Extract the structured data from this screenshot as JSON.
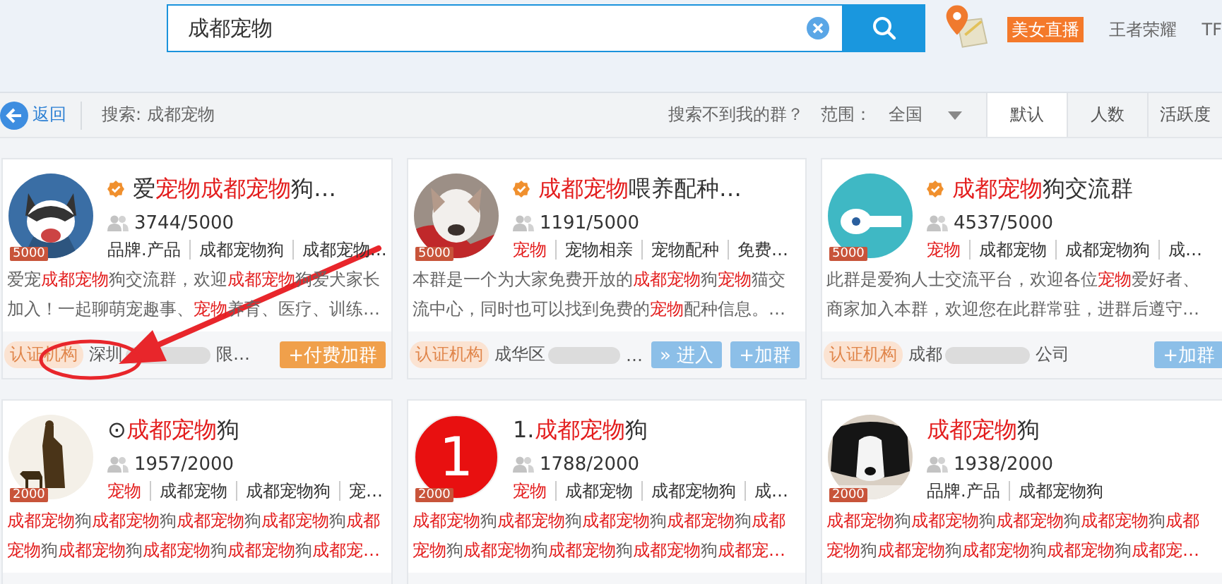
{
  "search": {
    "value": "成都宠物"
  },
  "header_links": [
    {
      "text": "美女直播",
      "kind": "badge"
    },
    {
      "text": "王者荣耀",
      "kind": "link"
    },
    {
      "text": "TF",
      "kind": "link"
    }
  ],
  "toolbar": {
    "back": "返回",
    "query": "搜索: 成都宠物",
    "hint": "搜索不到我的群？",
    "range_label": "范围：",
    "range_value": "全国"
  },
  "sort_tabs": [
    {
      "label": "默认",
      "selected": true
    },
    {
      "label": "人数",
      "selected": false
    },
    {
      "label": "活跃度",
      "selected": false
    }
  ],
  "groups": [
    {
      "verified": true,
      "avatar": {
        "kind": "picture"
      },
      "capacity": "5000",
      "members": "3744/5000",
      "title": [
        {
          "t": "爱",
          "hl": false
        },
        {
          "t": "宠物成都宠物",
          "hl": true
        },
        {
          "t": "狗…",
          "hl": false
        }
      ],
      "tags": [
        {
          "text": "品牌.产品",
          "hl": false
        },
        {
          "text": "成都宠物狗",
          "hl": false
        },
        {
          "text": "成都宠物…",
          "hl": false
        }
      ],
      "desc": [
        [
          {
            "t": "爱宠",
            "hl": false
          },
          {
            "t": "成都宠物",
            "hl": true
          },
          {
            "t": "狗交流群，欢迎",
            "hl": false
          },
          {
            "t": "成都宠物",
            "hl": true
          },
          {
            "t": "狗爱犬家长",
            "hl": false
          }
        ],
        [
          {
            "t": "加入！一起聊萌宠趣事、",
            "hl": false
          },
          {
            "t": "宠物",
            "hl": true
          },
          {
            "t": "养育、医疗、训练…",
            "hl": false
          }
        ]
      ],
      "footer": {
        "badge": "认证机构",
        "location_start": "深圳",
        "redacted": true,
        "location_end": "限…",
        "buttons": [
          {
            "label": "+付费加群",
            "kind": "paid"
          }
        ]
      }
    },
    {
      "verified": true,
      "avatar": {
        "kind": "picture"
      },
      "capacity": "5000",
      "members": "1191/5000",
      "title": [
        {
          "t": "成都宠物",
          "hl": true
        },
        {
          "t": "喂养配种…",
          "hl": false
        }
      ],
      "tags": [
        {
          "text": "宠物",
          "hl": true
        },
        {
          "text": "宠物相亲",
          "hl": false
        },
        {
          "text": "宠物配种",
          "hl": false
        },
        {
          "text": "免费…",
          "hl": false
        }
      ],
      "desc": [
        [
          {
            "t": "本群是一个为大家免费开放的",
            "hl": false
          },
          {
            "t": "成都宠物",
            "hl": true
          },
          {
            "t": "狗",
            "hl": false
          },
          {
            "t": "宠物",
            "hl": true
          },
          {
            "t": "猫交",
            "hl": false
          }
        ],
        [
          {
            "t": "流中心，同时也可以找到免费的",
            "hl": false
          },
          {
            "t": "宠物",
            "hl": true
          },
          {
            "t": "配种信息。…",
            "hl": false
          }
        ]
      ],
      "footer": {
        "badge": "认证机构",
        "location_start": "成华区",
        "redacted": true,
        "location_end": "…",
        "buttons": [
          {
            "label": "» 进入",
            "kind": "enter"
          },
          {
            "label": "+加群",
            "kind": "join"
          }
        ]
      }
    },
    {
      "verified": true,
      "avatar": {
        "kind": "picture"
      },
      "capacity": "5000",
      "members": "4537/5000",
      "title": [
        {
          "t": "成都宠物",
          "hl": true
        },
        {
          "t": "狗交流群",
          "hl": false
        }
      ],
      "tags": [
        {
          "text": "宠物",
          "hl": true
        },
        {
          "text": "成都宠物",
          "hl": false
        },
        {
          "text": "成都宠物狗",
          "hl": false
        },
        {
          "text": "成…",
          "hl": false
        }
      ],
      "desc": [
        [
          {
            "t": "此群是爱狗人士交流平台，欢迎各位",
            "hl": false
          },
          {
            "t": "宠物",
            "hl": true
          },
          {
            "t": "爱好者、",
            "hl": false
          }
        ],
        [
          {
            "t": "商家加入本群，欢迎您在此群常驻，进群后遵守…",
            "hl": false
          }
        ]
      ],
      "footer": {
        "badge": "认证机构",
        "location_start": "成都",
        "redacted": true,
        "location_end": "公司",
        "buttons": [
          {
            "label": "+加群",
            "kind": "join"
          }
        ]
      }
    },
    {
      "verified": false,
      "avatar": {
        "kind": "picture"
      },
      "capacity": "2000",
      "members": "1957/2000",
      "title": [
        {
          "t": "⊙",
          "hl": false
        },
        {
          "t": "成都宠物",
          "hl": true
        },
        {
          "t": "狗",
          "hl": false
        }
      ],
      "tags": [
        {
          "text": "宠物",
          "hl": true
        },
        {
          "text": "成都宠物",
          "hl": false
        },
        {
          "text": "成都宠物狗",
          "hl": false
        },
        {
          "text": "宠…",
          "hl": false
        }
      ],
      "desc": [
        [
          {
            "t": "成都宠物",
            "hl": true
          },
          {
            "t": "狗",
            "hl": false
          },
          {
            "t": "成都宠物",
            "hl": true
          },
          {
            "t": "狗",
            "hl": false
          },
          {
            "t": "成都宠物",
            "hl": true
          },
          {
            "t": "狗",
            "hl": false
          },
          {
            "t": "成都宠物",
            "hl": true
          },
          {
            "t": "狗",
            "hl": false
          },
          {
            "t": "成都",
            "hl": true
          }
        ],
        [
          {
            "t": "宠物",
            "hl": true
          },
          {
            "t": "狗",
            "hl": false
          },
          {
            "t": "成都宠物",
            "hl": true
          },
          {
            "t": "狗",
            "hl": false
          },
          {
            "t": "成都宠物",
            "hl": true
          },
          {
            "t": "狗",
            "hl": false
          },
          {
            "t": "成都宠物",
            "hl": true
          },
          {
            "t": "狗",
            "hl": false
          },
          {
            "t": "成都宠…",
            "hl": true
          }
        ]
      ]
    },
    {
      "verified": false,
      "avatar": {
        "kind": "number",
        "text": "1"
      },
      "capacity": "2000",
      "members": "1788/2000",
      "title": [
        {
          "t": "1.",
          "hl": false
        },
        {
          "t": "成都宠物",
          "hl": true
        },
        {
          "t": "狗",
          "hl": false
        }
      ],
      "tags": [
        {
          "text": "宠物",
          "hl": true
        },
        {
          "text": "成都宠物",
          "hl": false
        },
        {
          "text": "成都宠物狗",
          "hl": false
        },
        {
          "text": "成…",
          "hl": false
        }
      ],
      "desc": [
        [
          {
            "t": "成都宠物",
            "hl": true
          },
          {
            "t": "狗",
            "hl": false
          },
          {
            "t": "成都宠物",
            "hl": true
          },
          {
            "t": "狗",
            "hl": false
          },
          {
            "t": "成都宠物",
            "hl": true
          },
          {
            "t": "狗",
            "hl": false
          },
          {
            "t": "成都宠物",
            "hl": true
          },
          {
            "t": "狗",
            "hl": false
          },
          {
            "t": "成都",
            "hl": true
          }
        ],
        [
          {
            "t": "宠物",
            "hl": true
          },
          {
            "t": "狗",
            "hl": false
          },
          {
            "t": "成都宠物",
            "hl": true
          },
          {
            "t": "狗",
            "hl": false
          },
          {
            "t": "成都宠物",
            "hl": true
          },
          {
            "t": "狗",
            "hl": false
          },
          {
            "t": "成都宠物",
            "hl": true
          },
          {
            "t": "狗",
            "hl": false
          },
          {
            "t": "成都宠…",
            "hl": true
          }
        ]
      ]
    },
    {
      "verified": false,
      "avatar": {
        "kind": "picture"
      },
      "capacity": "2000",
      "members": "1938/2000",
      "title": [
        {
          "t": "成都宠物",
          "hl": true
        },
        {
          "t": "狗",
          "hl": false
        }
      ],
      "tags": [
        {
          "text": "品牌.产品",
          "hl": false
        },
        {
          "text": "成都宠物狗",
          "hl": false
        }
      ],
      "desc": [
        [
          {
            "t": "成都宠物",
            "hl": true
          },
          {
            "t": "狗",
            "hl": false
          },
          {
            "t": "成都宠物",
            "hl": true
          },
          {
            "t": "狗",
            "hl": false
          },
          {
            "t": "成都宠物",
            "hl": true
          },
          {
            "t": "狗",
            "hl": false
          },
          {
            "t": "成都宠物",
            "hl": true
          },
          {
            "t": "狗",
            "hl": false
          },
          {
            "t": "成都",
            "hl": true
          }
        ],
        [
          {
            "t": "宠物",
            "hl": true
          },
          {
            "t": "狗",
            "hl": false
          },
          {
            "t": "成都宠物",
            "hl": true
          },
          {
            "t": "狗",
            "hl": false
          },
          {
            "t": "成都宠物",
            "hl": true
          },
          {
            "t": "狗",
            "hl": false
          },
          {
            "t": "成都宠物",
            "hl": true
          },
          {
            "t": "狗",
            "hl": false
          },
          {
            "t": "成都宠…",
            "hl": true
          }
        ]
      ]
    }
  ],
  "annotations": [
    {
      "kind": "arrow"
    },
    {
      "kind": "circle"
    }
  ]
}
